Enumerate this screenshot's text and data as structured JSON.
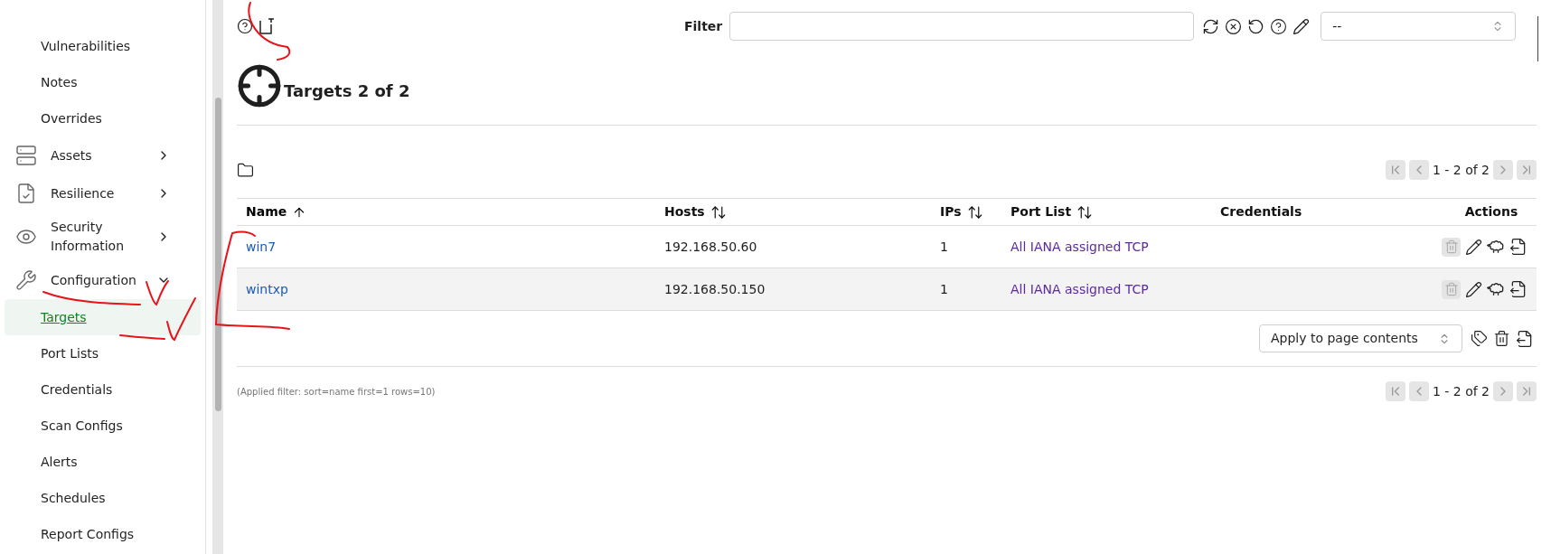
{
  "sidebar": {
    "items": [
      {
        "kind": "sub",
        "label": "Vulnerabilities",
        "selected": false
      },
      {
        "kind": "sub",
        "label": "Notes",
        "selected": false
      },
      {
        "kind": "sub",
        "label": "Overrides",
        "selected": false
      },
      {
        "kind": "group",
        "label": "Assets",
        "expanded": false
      },
      {
        "kind": "group",
        "label": "Resilience",
        "expanded": false
      },
      {
        "kind": "group",
        "label": "Security Information",
        "expanded": false
      },
      {
        "kind": "group",
        "label": "Configuration",
        "expanded": true
      },
      {
        "kind": "sub",
        "label": "Targets",
        "selected": true
      },
      {
        "kind": "sub",
        "label": "Port Lists",
        "selected": false
      },
      {
        "kind": "sub",
        "label": "Credentials",
        "selected": false
      },
      {
        "kind": "sub",
        "label": "Scan Configs",
        "selected": false
      },
      {
        "kind": "sub",
        "label": "Alerts",
        "selected": false
      },
      {
        "kind": "sub",
        "label": "Schedules",
        "selected": false
      },
      {
        "kind": "sub",
        "label": "Report Configs",
        "selected": false
      }
    ]
  },
  "filter": {
    "label": "Filter",
    "preset": "--"
  },
  "title": "Targets 2 of 2",
  "pagination_top": {
    "text": "1 - 2 of 2",
    "disabled": true
  },
  "table": {
    "columns": [
      {
        "label": "Name",
        "sortable": true,
        "sorted": true
      },
      {
        "label": "Hosts",
        "sortable": true,
        "sorted": false
      },
      {
        "label": "IPs",
        "sortable": true,
        "sorted": false
      },
      {
        "label": "Port List",
        "sortable": true,
        "sorted": false
      },
      {
        "label": "Credentials",
        "sortable": false,
        "sorted": false
      },
      {
        "label": "Actions",
        "sortable": false,
        "sorted": false
      }
    ],
    "rows": [
      {
        "name": "win7",
        "hosts": "192.168.50.60",
        "ips": "1",
        "port_list": "All IANA assigned TCP",
        "delete_disabled": true
      },
      {
        "name": "wintxp",
        "hosts": "192.168.50.150",
        "ips": "1",
        "port_list": "All IANA assigned TCP",
        "delete_disabled": true
      }
    ]
  },
  "bulk_action": {
    "value": "Apply to page contents"
  },
  "applied_filter": "(Applied filter: sort=name first=1 rows=10)",
  "pagination_bottom": {
    "text": "1 - 2 of 2",
    "disabled": true
  }
}
